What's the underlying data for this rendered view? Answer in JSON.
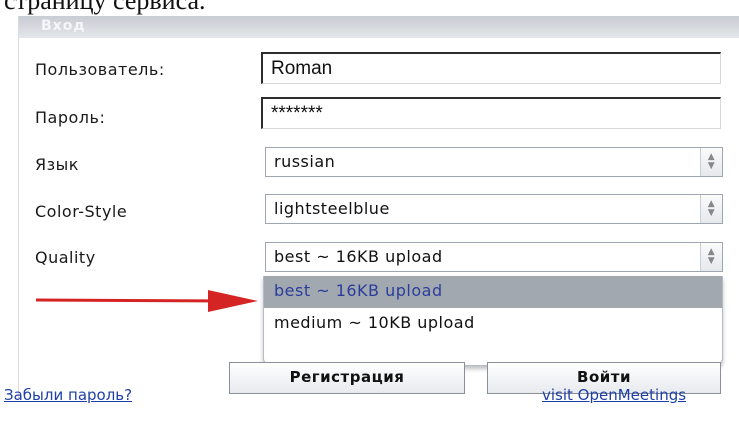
{
  "top_fragment": "страницу сервиса.",
  "dialog": {
    "title": "Вход",
    "fields": {
      "user_label": "Пользователь:",
      "user_value": "Roman",
      "password_label": "Пароль:",
      "password_value": "*******",
      "language_label": "Язык",
      "language_value": "russian",
      "color_label": "Color-Style",
      "color_value": "lightsteelblue",
      "quality_label": "Quality",
      "quality_value": "best ~ 16KB upload"
    },
    "quality_options": [
      {
        "label": "best ~ 16KB upload",
        "selected": true
      },
      {
        "label": "medium ~ 10KB upload",
        "selected": false
      }
    ],
    "buttons": {
      "register": "Регистрация",
      "login": "Войти"
    },
    "links": {
      "forgot": "Забыли пароль?",
      "visit": "visit OpenMeetings"
    }
  },
  "colors": {
    "arrow": "#d42424",
    "link": "#1f3fa6",
    "highlight": "#a2a8b0"
  }
}
